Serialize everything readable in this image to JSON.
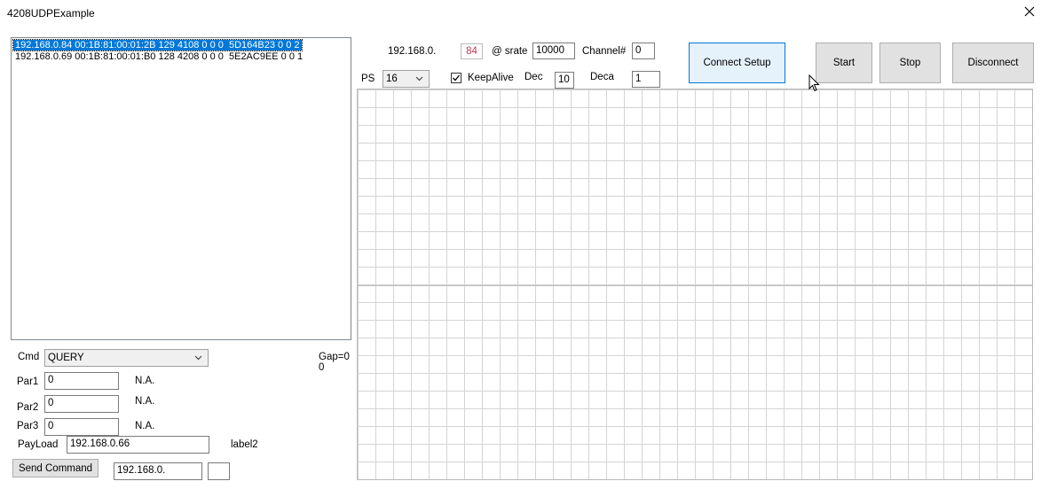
{
  "window": {
    "title": "4208UDPExample"
  },
  "device_list": {
    "items": [
      "192.168.0.84 00:1B:81:00:01:2B 129 4108 0 0 0  5D164B23 0 0 2",
      "192.168.0.69 00:1B:81:00:01:B0 128 4208 0 0 0  5E2AC9EE 0 0 1"
    ],
    "selected_index": 0
  },
  "controls": {
    "ip_prefix": "192.168.0.",
    "ip_last": "84",
    "srate_label": "@ srate",
    "srate": "10000",
    "channel_label": "Channel#",
    "channel": "0",
    "ps_label": "PS",
    "ps_value": "16",
    "keepalive_label": "KeepAlive",
    "keepalive_checked": true,
    "dec_label": "Dec",
    "dec": "10",
    "deca_label": "Deca",
    "deca": "1"
  },
  "buttons": {
    "connect_setup": "Connect Setup",
    "start": "Start",
    "stop": "Stop",
    "disconnect": "Disconnect",
    "send_command": "Send Command"
  },
  "command_panel": {
    "cmd_label": "Cmd",
    "cmd_value": "QUERY",
    "gap_label": "Gap=0",
    "gap_value": "0",
    "par1_label": "Par1",
    "par1": "0",
    "par1_note": "N.A.",
    "par2_label": "Par2",
    "par2": "0",
    "par2_note": "N.A.",
    "par3_label": "Par3",
    "par3": "0",
    "par3_note": "N.A.",
    "payload_label": "PayLoad",
    "payload": "192.168.0.66",
    "label2": "label2",
    "send_ip": "192.168.0.",
    "send_extra": ""
  }
}
